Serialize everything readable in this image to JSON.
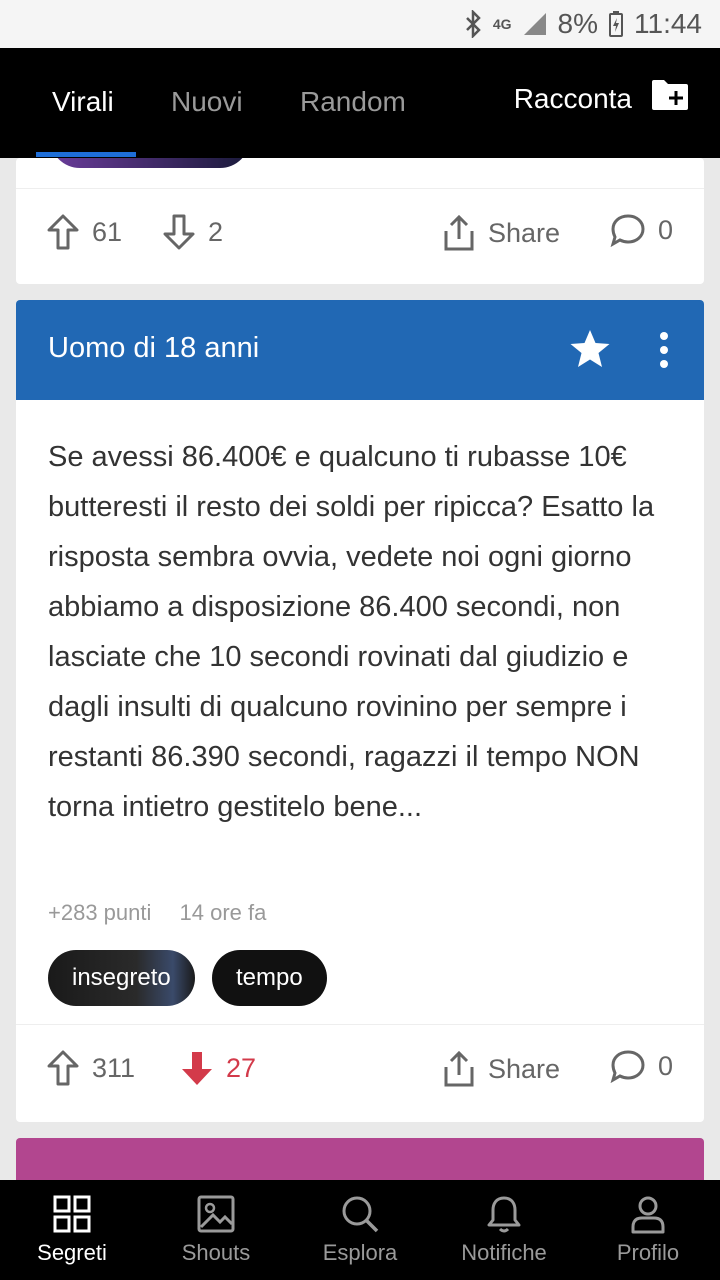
{
  "status_bar": {
    "network": "4G",
    "battery": "8%",
    "time": "11:44"
  },
  "top_tabs": {
    "tabs": [
      {
        "label": "Virali",
        "active": true
      },
      {
        "label": "Nuovi",
        "active": false
      },
      {
        "label": "Random",
        "active": false
      }
    ],
    "racconta_label": "Racconta"
  },
  "prev_post": {
    "upvotes": "61",
    "downvotes": "2",
    "share_label": "Share",
    "comments": "0"
  },
  "post": {
    "header_title": "Uomo di 18 anni",
    "header_color": "#2168b4",
    "body": "Se avessi 86.400€ e qualcuno ti rubasse 10€ butteresti il resto dei soldi per ripicca? Esatto la risposta sembra ovvia, vedete noi ogni giorno abbiamo a disposizione 86.400 secondi, non lasciate che 10 secondi rovinati dal giudizio e dagli insulti di qualcuno rovinino per sempre i restanti 86.390 secondi, ragazzi il tempo NON torna intietro gestitelo bene...",
    "points": "+283 punti",
    "time_ago": "14 ore fa",
    "tags": [
      "insegreto",
      "tempo"
    ],
    "upvotes": "311",
    "downvotes": "27",
    "downvote_color": "#d33a4a",
    "share_label": "Share",
    "comments": "0"
  },
  "next_post": {
    "header_color": "#b2468f"
  },
  "bottom_nav": {
    "items": [
      {
        "label": "Segreti",
        "icon": "grid-icon",
        "active": true
      },
      {
        "label": "Shouts",
        "icon": "image-icon",
        "active": false
      },
      {
        "label": "Esplora",
        "icon": "search-icon",
        "active": false
      },
      {
        "label": "Notifiche",
        "icon": "bell-icon",
        "active": false
      },
      {
        "label": "Profilo",
        "icon": "person-icon",
        "active": false
      }
    ]
  }
}
